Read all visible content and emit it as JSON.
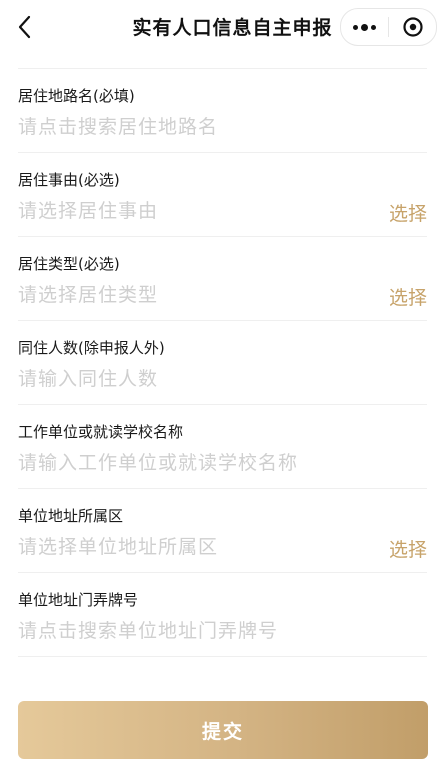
{
  "header": {
    "back_icon": "chevron-left-icon",
    "title": "实有人口信息自主申报",
    "more_icon": "more-dots-icon",
    "close_icon": "target-circle-icon"
  },
  "form": {
    "fields": [
      {
        "label": "居住地路名(必填)",
        "placeholder": "请点击搜索居住地路名",
        "value": ""
      },
      {
        "label": "居住事由(必选)",
        "placeholder": "请选择居住事由",
        "value": "",
        "action": "选择"
      },
      {
        "label": "居住类型(必选)",
        "placeholder": "请选择居住类型",
        "value": "",
        "action": "选择"
      },
      {
        "label": "同住人数(除申报人外)",
        "placeholder": "请输入同住人数",
        "value": ""
      },
      {
        "label": "工作单位或就读学校名称",
        "placeholder": "请输入工作单位或就读学校名称",
        "value": ""
      },
      {
        "label": "单位地址所属区",
        "placeholder": "请选择单位地址所属区",
        "value": "",
        "action": "选择"
      },
      {
        "label": "单位地址门弄牌号",
        "placeholder": "请点击搜索单位地址门弄牌号",
        "value": ""
      }
    ]
  },
  "submit_label": "提交",
  "colors": {
    "accent": "#c7a36a",
    "button_gradient_start": "#e5c99a",
    "button_gradient_end": "#c19e69",
    "placeholder": "#cfcfcf",
    "divider": "#efefef"
  }
}
